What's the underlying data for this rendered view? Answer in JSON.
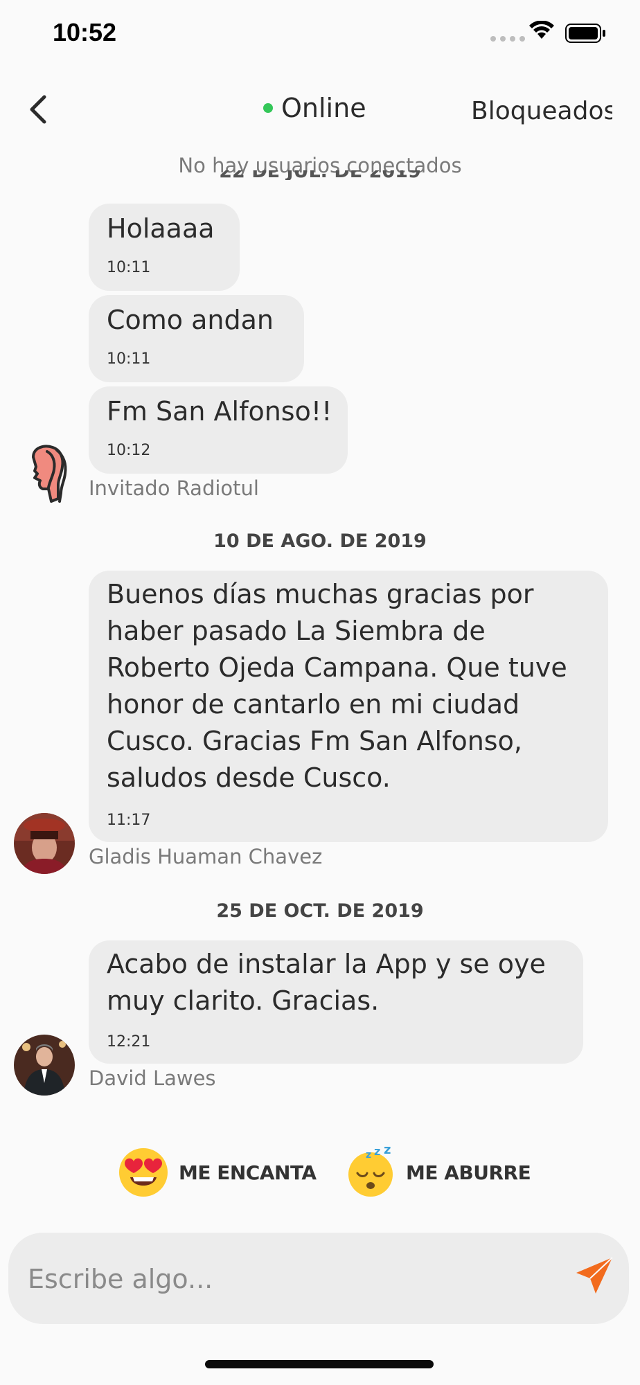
{
  "status_bar": {
    "time": "10:52"
  },
  "header": {
    "online_label": "Online",
    "blocked_label": "Bloqueados",
    "no_users_text": "No hay usuarios conectados",
    "clipped_date": "22 DE JUL. DE 2019"
  },
  "messages": [
    {
      "text": "Holaaaa",
      "time": "10:11"
    },
    {
      "text": "Como andan",
      "time": "10:11"
    },
    {
      "text": "Fm San Alfonso!!",
      "time": "10:12",
      "sender": "Invitado Radiotul"
    },
    {
      "text": "Buenos días muchas gracias por\nhaber pasado La Siembra de\nRoberto Ojeda Campana. Que tuve\nhonor de cantarlo en mi ciudad\nCusco. Gracias Fm San Alfonso,\nsaludos desde Cusco.",
      "time": "11:17",
      "sender": "Gladis Huaman Chavez"
    },
    {
      "text": "Acabo de instalar la App y se oye\nmuy clarito. Gracias.",
      "time": "12:21",
      "sender": "David Lawes"
    }
  ],
  "date_separators": [
    "10 DE AGO. DE 2019",
    "25 DE OCT. DE 2019"
  ],
  "reactions": [
    {
      "label": "ME ENCANTA",
      "icon": "heart-eyes-emoji-icon"
    },
    {
      "label": "ME ABURRE",
      "icon": "sleeping-emoji-icon"
    }
  ],
  "input": {
    "placeholder": "Escribe algo..."
  },
  "colors": {
    "accent": "#f26b1d",
    "bubble": "#ececec",
    "online": "#34c759"
  }
}
